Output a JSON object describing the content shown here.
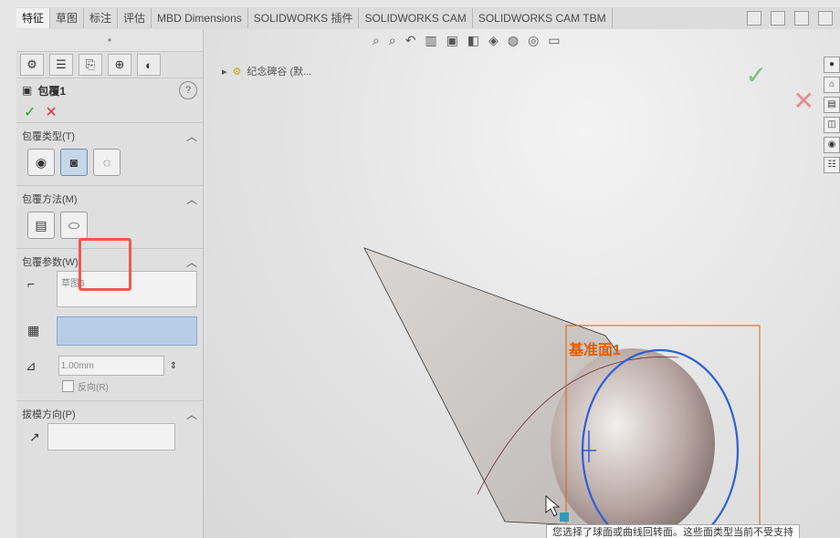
{
  "tabs": [
    "特征",
    "草图",
    "标注",
    "评估",
    "MBD Dimensions",
    "SOLIDWORKS 插件",
    "SOLIDWORKS CAM",
    "SOLIDWORKS CAM TBM"
  ],
  "active_tab": "特征",
  "panel": {
    "feature_title": "包覆1",
    "help_glyph": "?",
    "ok_glyph": "✓",
    "cancel_glyph": "✕",
    "wrap_type": {
      "header": "包覆类型(T)"
    },
    "wrap_method": {
      "header": "包覆方法(M)"
    },
    "wrap_params": {
      "header": "包覆参数(W)",
      "sketch_value": "草图6",
      "thickness_value": "1.00mm",
      "reverse_label": "反向(R)"
    },
    "pull_direction": {
      "header": "拔模方向(P)"
    }
  },
  "breadcrumb": {
    "text": "纪念碑谷 (默..."
  },
  "graphics": {
    "plane_label": "基准面1",
    "tooltip": "您选择了球面或曲线回转面。这些面类型当前不受支持"
  },
  "colors": {
    "plane_orange": "#e35b00",
    "highlight_red": "#f0584a",
    "circle_blue": "#2e5fd6",
    "selection_blue": "#b8cde6"
  }
}
